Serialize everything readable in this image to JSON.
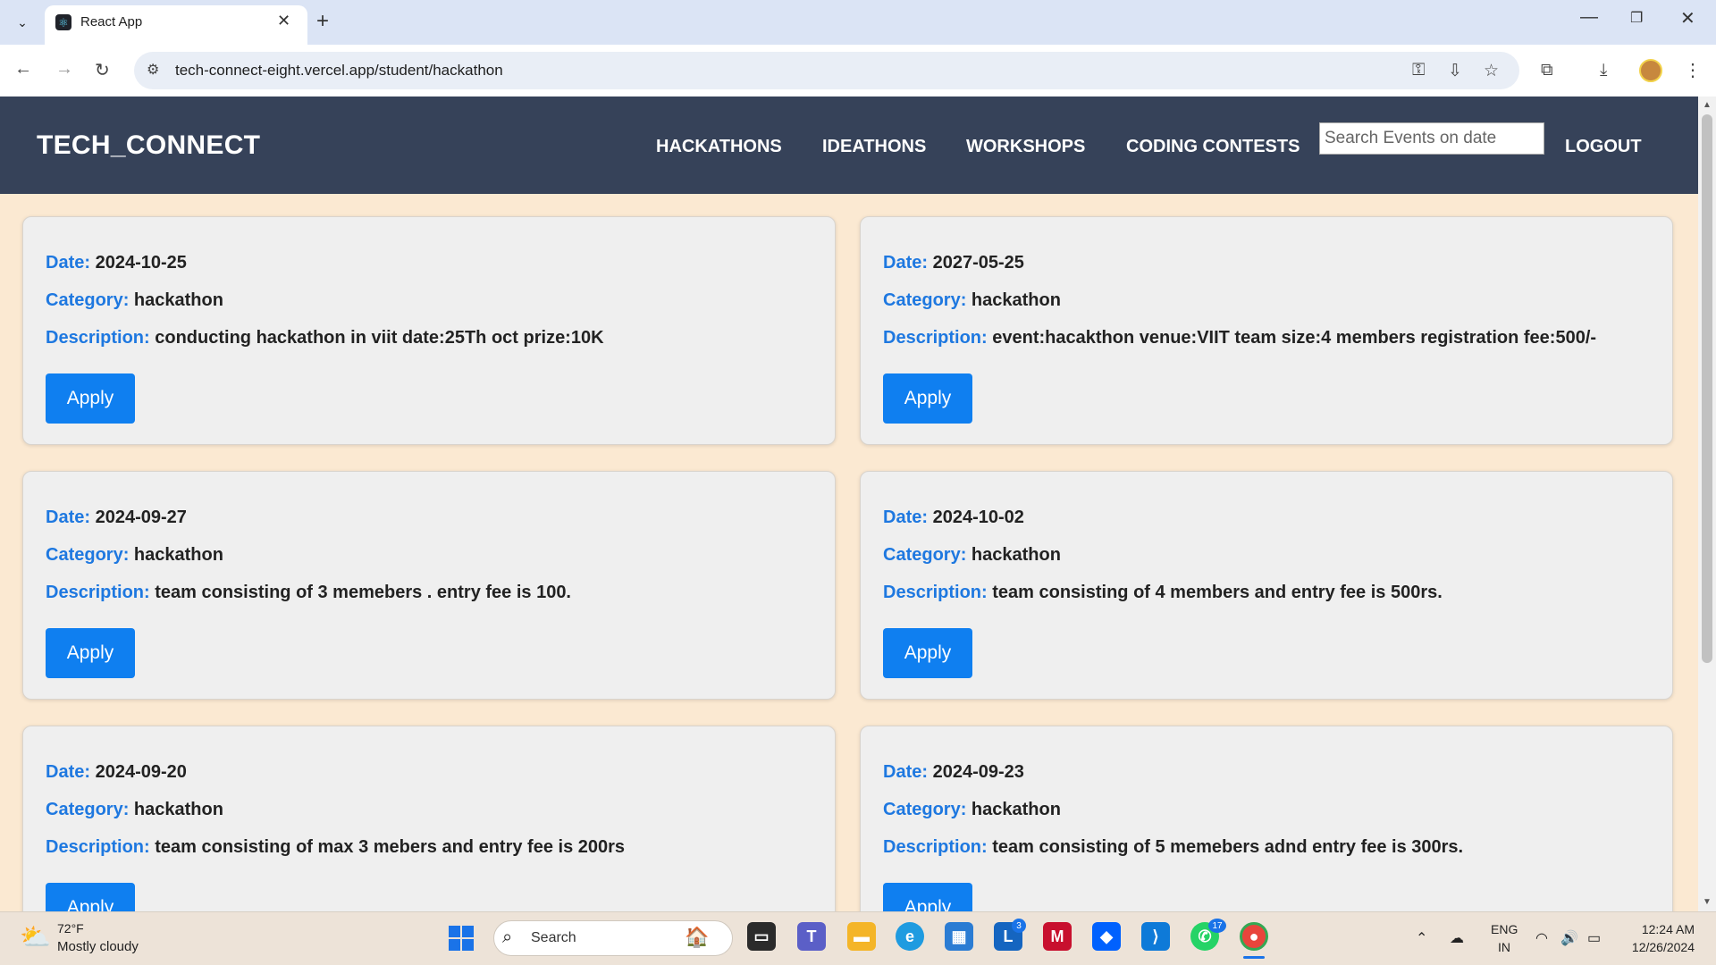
{
  "browser": {
    "tab_title": "React App",
    "url": "tech-connect-eight.vercel.app/student/hackathon",
    "new_tab_symbol": "+",
    "close_symbol": "✕"
  },
  "app": {
    "brand": "TECH_CONNECT",
    "nav": {
      "hackathons": "HACKATHONS",
      "ideathons": "IDEATHONS",
      "workshops": "WORKSHOPS",
      "coding_contests": "CODING CONTESTS",
      "logout": "LOGOUT"
    },
    "search": {
      "placeholder": "Search Events on date",
      "value": ""
    },
    "labels": {
      "date": "Date:",
      "category": "Category:",
      "description": "Description:"
    },
    "apply_label": "Apply",
    "events": [
      {
        "date": "2024-10-25",
        "category": "hackathon",
        "description": "conducting hackathon in viit date:25Th oct prize:10K"
      },
      {
        "date": "2027-05-25",
        "category": "hackathon",
        "description": "event:hacakthon venue:VIIT team size:4 members registration fee:500/-"
      },
      {
        "date": "2024-09-27",
        "category": "hackathon",
        "description": "team consisting of 3 memebers . entry fee is 100."
      },
      {
        "date": "2024-10-02",
        "category": "hackathon",
        "description": "team consisting of 4 members and entry fee is 500rs."
      },
      {
        "date": "2024-09-20",
        "category": "hackathon",
        "description": "team consisting of max 3 mebers and entry fee is 200rs"
      },
      {
        "date": "2024-09-23",
        "category": "hackathon",
        "description": "team consisting of 5 memebers adnd entry fee is 300rs."
      }
    ]
  },
  "taskbar": {
    "weather_temp": "72°F",
    "weather_desc": "Mostly cloudy",
    "search_label": "Search",
    "badge_lens": "3",
    "badge_whatsapp": "17",
    "lang_line1": "ENG",
    "lang_line2": "IN",
    "time": "12:24 AM",
    "date": "12/26/2024",
    "app_letter_l": "L"
  },
  "colors": {
    "nav_bg": "#364259",
    "page_bg": "#fbe9d2",
    "label_blue": "#1e78e0",
    "button_blue": "#0f7ff0",
    "card_bg": "#efefef"
  }
}
